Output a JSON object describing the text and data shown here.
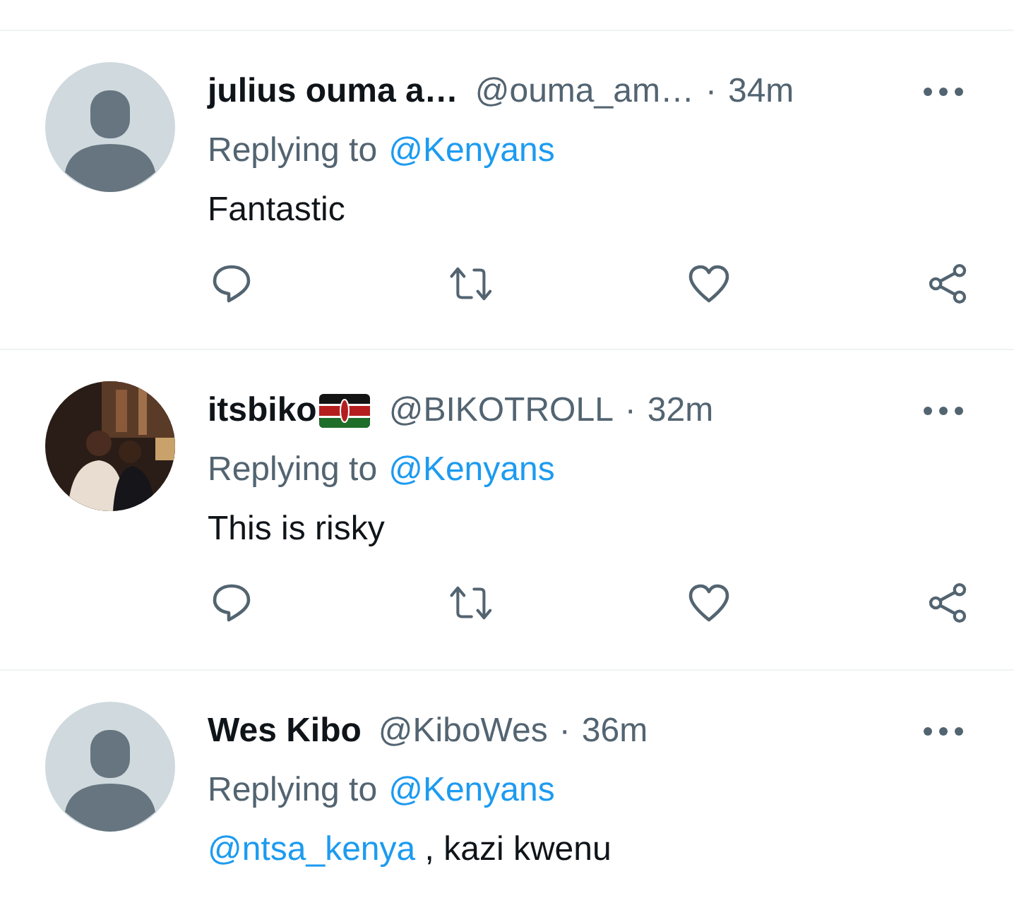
{
  "tweets": [
    {
      "name": "julius ouma a…",
      "flag": false,
      "handle": "@ouma_am…",
      "dot": "·",
      "time": "34m",
      "avatar": {
        "kind": "default"
      },
      "replying_label": "Replying to",
      "replying_to": "@Kenyans",
      "text": [
        {
          "kind": "plain",
          "text": "Fantastic"
        }
      ],
      "actions": true
    },
    {
      "name": "itsbiko",
      "flag": true,
      "handle": "@BIKOTROLL",
      "dot": "·",
      "time": "32m",
      "avatar": {
        "kind": "picture"
      },
      "replying_label": "Replying to",
      "replying_to": "@Kenyans",
      "text": [
        {
          "kind": "plain",
          "text": "This is risky"
        }
      ],
      "actions": true
    },
    {
      "name": "Wes Kibo",
      "flag": false,
      "handle": "@KiboWes",
      "dot": "·",
      "time": "36m",
      "avatar": {
        "kind": "default"
      },
      "replying_label": "Replying to",
      "replying_to": "@Kenyans",
      "text": [
        {
          "kind": "mention",
          "text": "@ntsa_kenya"
        },
        {
          "kind": "plain",
          "text": " , kazi kwenu"
        }
      ],
      "actions": false
    }
  ]
}
